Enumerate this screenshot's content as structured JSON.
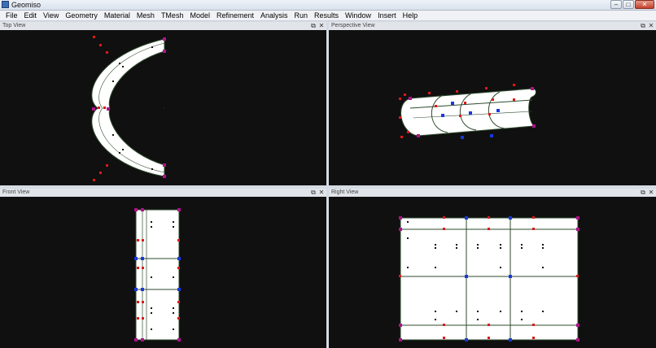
{
  "window": {
    "title": "Geomiso",
    "minimize_glyph": "–",
    "maximize_glyph": "□",
    "close_glyph": "✕"
  },
  "menu": [
    "File",
    "Edit",
    "View",
    "Geometry",
    "Material",
    "Mesh",
    "TMesh",
    "Model",
    "Refinement",
    "Analysis",
    "Run",
    "Results",
    "Window",
    "Insert",
    "Help"
  ],
  "viewports": {
    "top": {
      "title": "Top View"
    },
    "perspective": {
      "title": "Perspective View"
    },
    "front": {
      "title": "Front View"
    },
    "right": {
      "title": "Right View"
    }
  },
  "viewport_icons": {
    "float_glyph": "⧉",
    "close_glyph": "✕"
  },
  "colors": {
    "background": "#101010",
    "surface": "#ffffff",
    "edge": "#2d4a2d",
    "control_red": "#e01818",
    "control_blue": "#1838e0",
    "control_magenta": "#b0108a",
    "marker_black": "#111111"
  }
}
